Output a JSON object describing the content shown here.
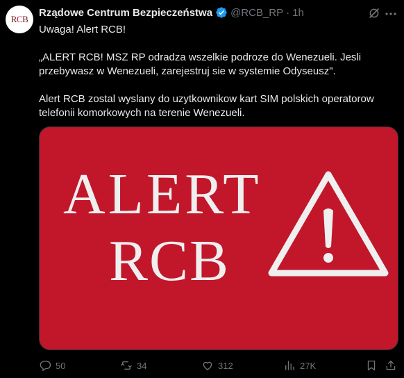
{
  "author": {
    "avatar_text": "RCB",
    "name": "Rządowe Centrum Bezpieczeństwa",
    "handle": "@RCB_RP",
    "separator": "·",
    "time": "1h"
  },
  "post": {
    "line1": "Uwaga! Alert RCB!",
    "quote": "„ALERT RCB! MSZ RP odradza wszelkie podroze do Wenezueli. Jesli przebywasz w Wenezueli, zarejestruj sie w systemie Odyseusz\".",
    "info": "Alert RCB zostal wyslany do uzytkownikow kart SIM polskich operatorow telefonii komorkowych na terenie Wenezueli."
  },
  "media": {
    "line1": "ALERT",
    "line2": "RCB",
    "bg_color": "#c2162a"
  },
  "actions": {
    "replies": "50",
    "reposts": "34",
    "likes": "312",
    "views": "27K"
  },
  "icons": [
    "verified-icon",
    "grok-icon",
    "more-icon",
    "reply-icon",
    "repost-icon",
    "like-icon",
    "views-icon",
    "bookmark-icon",
    "share-icon",
    "warning-triangle-icon"
  ]
}
